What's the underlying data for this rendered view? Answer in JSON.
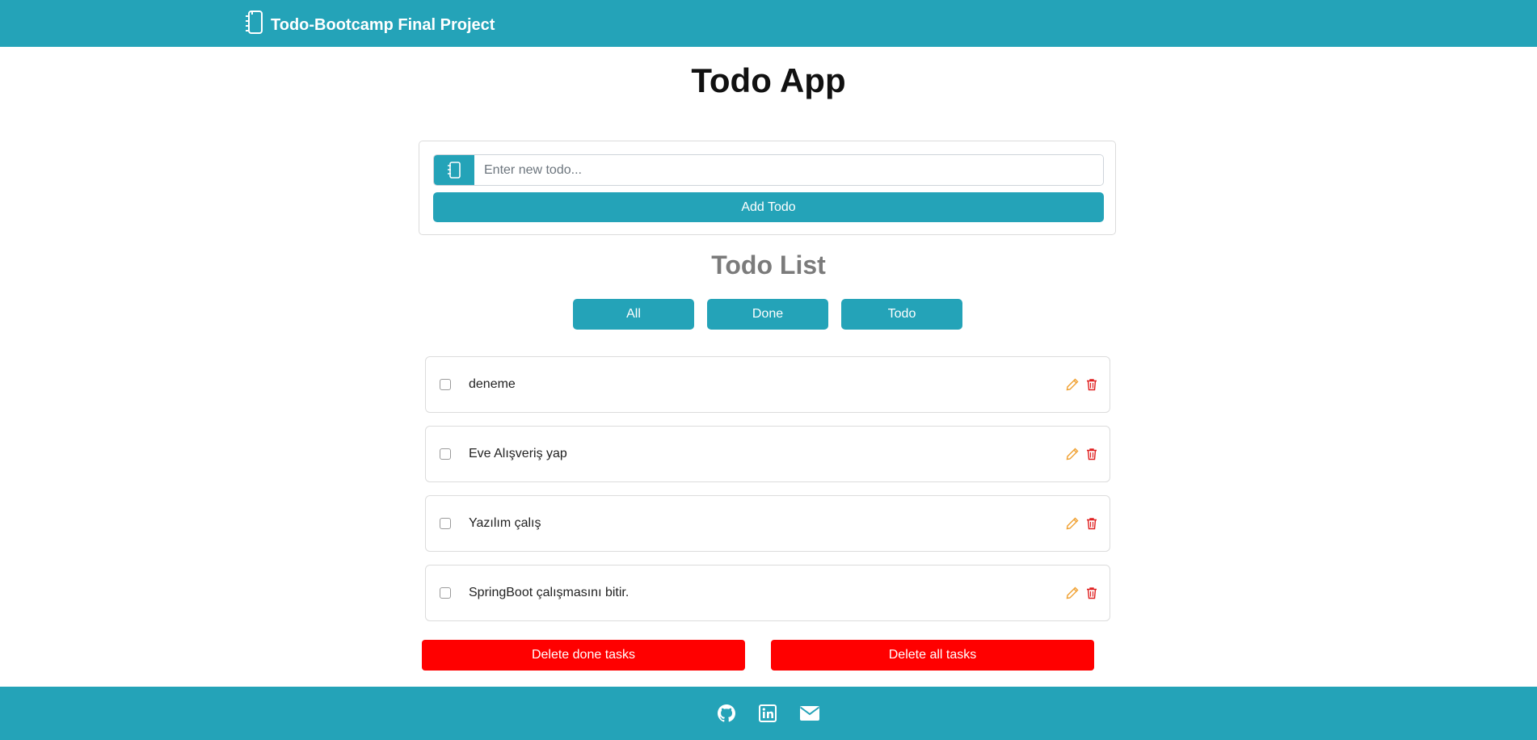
{
  "navbar": {
    "brand": "Todo-Bootcamp Final Project",
    "brand_icon": "notebook-icon"
  },
  "page": {
    "title": "Todo App"
  },
  "add_form": {
    "placeholder": "Enter new todo...",
    "value": "",
    "input_icon": "notebook-icon",
    "add_label": "Add Todo"
  },
  "list": {
    "title": "Todo List",
    "filters": [
      "All",
      "Done",
      "Todo"
    ],
    "items": [
      {
        "text": "deneme",
        "done": false
      },
      {
        "text": "Eve Alışveriş yap",
        "done": false
      },
      {
        "text": "Yazılım çalış",
        "done": false
      },
      {
        "text": "SpringBoot çalışmasını bitir.",
        "done": false
      }
    ]
  },
  "actions": {
    "delete_done": "Delete done tasks",
    "delete_all": "Delete all tasks"
  },
  "footer": {
    "icons": [
      "github-icon",
      "linkedin-icon",
      "envelope-icon"
    ]
  },
  "colors": {
    "primary": "#24a3b8",
    "danger": "#ff0000",
    "edit": "#f0a030",
    "trash": "#e02020"
  }
}
